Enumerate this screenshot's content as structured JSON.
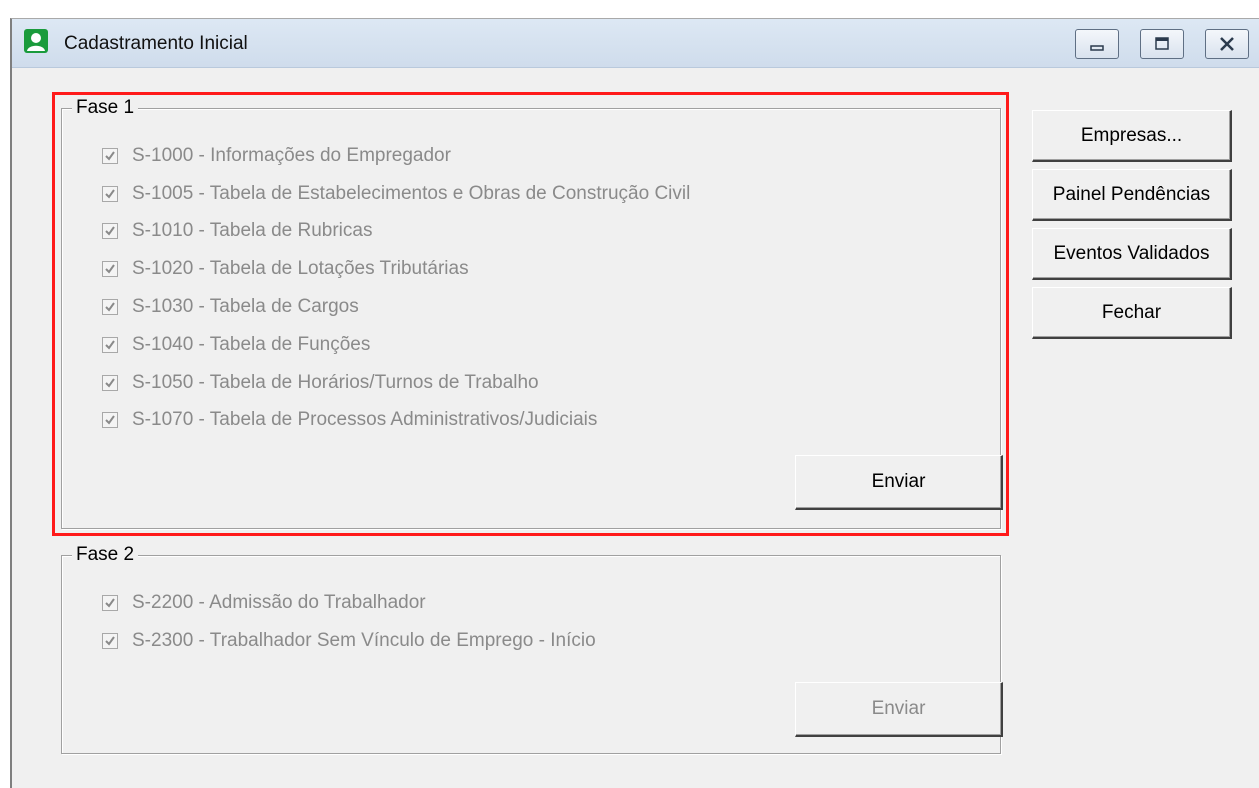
{
  "window": {
    "title": "Cadastramento Inicial"
  },
  "icons": {
    "app": "person-icon",
    "minimize": "minimize-icon",
    "maximize": "maximize-icon",
    "close": "close-icon",
    "check": "checkmark-icon"
  },
  "colors": {
    "highlight": "#ff1a1a",
    "app_icon": "#1a9b3c",
    "disabled_text": "#8a8a8a"
  },
  "fase1": {
    "legend": "Fase 1",
    "events": [
      {
        "label": "S-1000 - Informações do Empregador",
        "checked": true
      },
      {
        "label": "S-1005 - Tabela de Estabelecimentos e Obras de Construção Civil",
        "checked": true
      },
      {
        "label": "S-1010 - Tabela de Rubricas",
        "checked": true
      },
      {
        "label": "S-1020 - Tabela de Lotações Tributárias",
        "checked": true
      },
      {
        "label": "S-1030 - Tabela de Cargos",
        "checked": true
      },
      {
        "label": "S-1040 - Tabela de Funções",
        "checked": true
      },
      {
        "label": "S-1050 - Tabela de Horários/Turnos de Trabalho",
        "checked": true
      },
      {
        "label": "S-1070 - Tabela de Processos Administrativos/Judiciais",
        "checked": true
      }
    ],
    "send_label": "Enviar"
  },
  "fase2": {
    "legend": "Fase 2",
    "events": [
      {
        "label": "S-2200 - Admissão do Trabalhador",
        "checked": true
      },
      {
        "label": "S-2300 - Trabalhador Sem Vínculo de Emprego - Início",
        "checked": true
      }
    ],
    "send_label": "Enviar"
  },
  "side_buttons": {
    "empresas": "Empresas...",
    "painel": "Painel Pendências",
    "eventos": "Eventos Validados",
    "fechar": "Fechar"
  }
}
